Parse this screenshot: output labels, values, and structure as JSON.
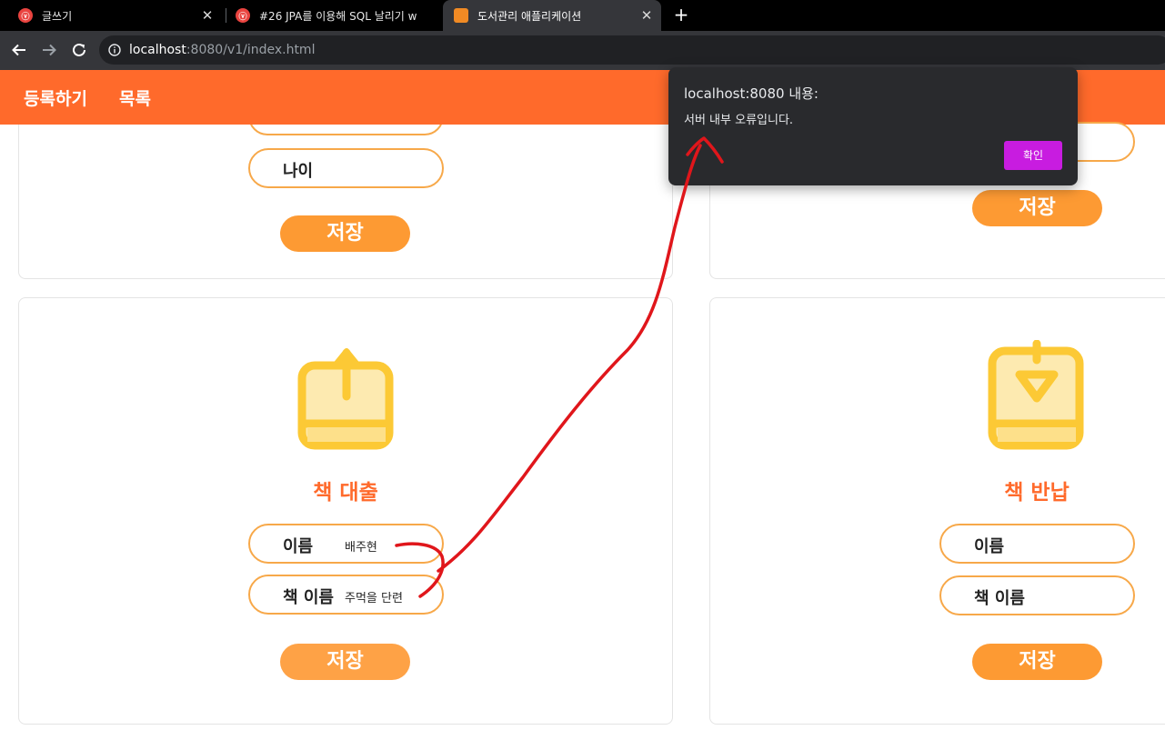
{
  "browser": {
    "tabs": [
      {
        "title": "글쓰기",
        "favicon": "velog-icon",
        "favicon_glyph": "ⓥ",
        "active": false
      },
      {
        "title": "#26 JPA를 이용해 SQL 날리기 w",
        "favicon": "velog-icon",
        "favicon_glyph": "ⓥ",
        "active": false
      },
      {
        "title": "도서관리 애플리케이션",
        "favicon": "book-favicon",
        "favicon_glyph": "📖",
        "active": true
      }
    ],
    "new_tab_label": "+",
    "close_glyph": "✕",
    "url_host": "localhost",
    "url_path": ":8080/v1/index.html"
  },
  "nav": {
    "register": "등록하기",
    "list": "목록"
  },
  "user_card": {
    "age_label": "나이",
    "save_label": "저장"
  },
  "top_right_card": {
    "save_label": "저장"
  },
  "loan_card": {
    "title": "책 대출",
    "name_label": "이름",
    "name_value": "배주현",
    "book_label": "책 이름",
    "book_value": "주먹을 단련",
    "save_label": "저장",
    "icon": "book-upload-icon"
  },
  "return_card": {
    "title": "책 반납",
    "name_label": "이름",
    "book_label": "책 이름",
    "save_label": "저장",
    "icon": "book-download-icon"
  },
  "alert": {
    "title": "localhost:8080 내용:",
    "message": "서버 내부 오류입니다.",
    "ok_label": "확인"
  },
  "colors": {
    "brand_orange": "#ff6a2b",
    "button_orange": "#fd9a33",
    "pill_border": "#f7a849",
    "icon_yellow": "#fcc935",
    "icon_light": "#fdeab0",
    "dialog_button": "#c81ce0",
    "annotation_red": "#e0161b"
  }
}
